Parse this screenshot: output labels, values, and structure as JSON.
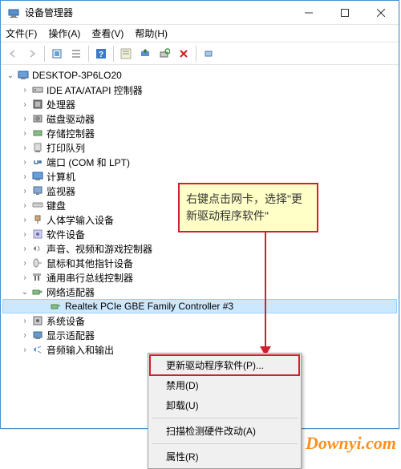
{
  "window": {
    "title": "设备管理器"
  },
  "menubar": {
    "file": "文件(F)",
    "action": "操作(A)",
    "view": "查看(V)",
    "help": "帮助(H)"
  },
  "tree": {
    "root": "DESKTOP-3P6LO20",
    "items": [
      {
        "label": "IDE ATA/ATAPI 控制器"
      },
      {
        "label": "处理器"
      },
      {
        "label": "磁盘驱动器"
      },
      {
        "label": "存储控制器"
      },
      {
        "label": "打印队列"
      },
      {
        "label": "端口 (COM 和 LPT)"
      },
      {
        "label": "计算机"
      },
      {
        "label": "监视器"
      },
      {
        "label": "键盘"
      },
      {
        "label": "人体学输入设备"
      },
      {
        "label": "软件设备"
      },
      {
        "label": "声音、视频和游戏控制器"
      },
      {
        "label": "鼠标和其他指针设备"
      },
      {
        "label": "通用串行总线控制器"
      },
      {
        "label": "网络适配器",
        "expanded": true,
        "children": [
          {
            "label": "Realtek PCIe GBE Family Controller #3",
            "selected": true
          }
        ]
      },
      {
        "label": "系统设备"
      },
      {
        "label": "显示适配器"
      },
      {
        "label": "音频输入和输出"
      }
    ]
  },
  "context_menu": {
    "update": "更新驱动程序软件(P)...",
    "disable": "禁用(D)",
    "uninstall": "卸载(U)",
    "scan": "扫描检测硬件改动(A)",
    "properties": "属性(R)"
  },
  "tooltip": {
    "text": "右键点击网卡，选择\"更新驱动程序软件\""
  },
  "watermark": "Downyi.com"
}
